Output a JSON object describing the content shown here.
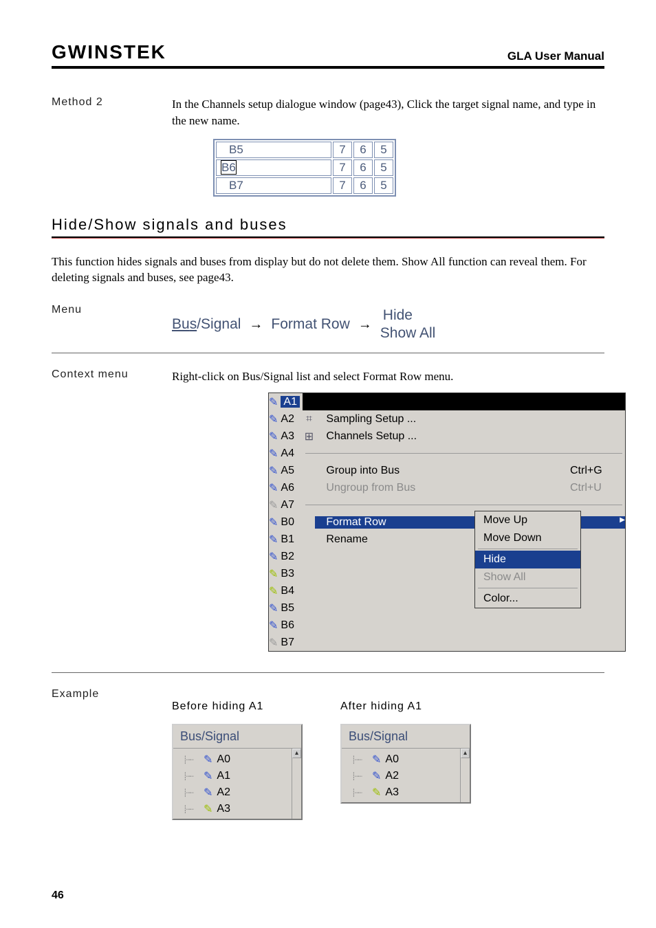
{
  "header": {
    "brand": "GWINSTEK",
    "title": "GLA User Manual"
  },
  "method2": {
    "label": "Method 2",
    "text": "In the Channels setup dialogue window (page43), Click the target signal name, and type in the new name.",
    "rows": [
      {
        "name": "B5",
        "c1": "7",
        "c2": "6",
        "c3": "5"
      },
      {
        "name": "B6",
        "c1": "7",
        "c2": "6",
        "c3": "5"
      },
      {
        "name": "B7",
        "c1": "7",
        "c2": "6",
        "c3": "5"
      }
    ]
  },
  "section": {
    "title": "Hide/Show signals and buses"
  },
  "intro": "This function hides signals and buses from display but do not delete them. Show All function can reveal them. For deleting signals and buses, see page43.",
  "menu": {
    "label": "Menu",
    "path": {
      "a": "Bus/Signal",
      "b": "Format Row",
      "c1": "Hide",
      "c2": "Show All"
    }
  },
  "context": {
    "label": "Context menu",
    "text": "Right-click on Bus/Signal list and select Format Row menu.",
    "signals": [
      "A1",
      "A2",
      "A3",
      "A4",
      "A5",
      "A6",
      "A7",
      "B0",
      "B1",
      "B2",
      "B3",
      "B4",
      "B5",
      "B6",
      "B7"
    ],
    "items": {
      "sampling": "Sampling Setup ...",
      "channels": "Channels Setup ...",
      "group": "Group into Bus",
      "group_sc": "Ctrl+G",
      "ungroup": "Ungroup from Bus",
      "ungroup_sc": "Ctrl+U",
      "format": "Format Row",
      "rename": "Rename"
    },
    "submenu": {
      "moveup": "Move Up",
      "movedown": "Move Down",
      "hide": "Hide",
      "showall": "Show All",
      "color": "Color..."
    }
  },
  "example": {
    "label": "Example",
    "before": {
      "title": "Before hiding A1",
      "header": "Bus/Signal",
      "items": [
        "A0",
        "A1",
        "A2",
        "A3"
      ]
    },
    "after": {
      "title": "After hiding A1",
      "header": "Bus/Signal",
      "items": [
        "A0",
        "A2",
        "A3"
      ]
    }
  },
  "page_number": "46"
}
